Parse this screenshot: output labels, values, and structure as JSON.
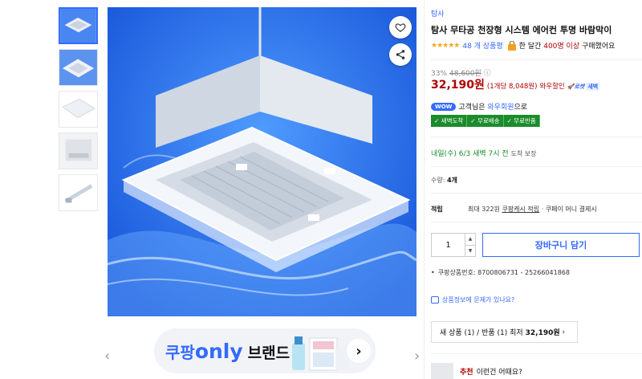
{
  "thumbnails": [
    {
      "name": "thumb-1",
      "active": true
    },
    {
      "name": "thumb-2",
      "active": false
    },
    {
      "name": "thumb-3",
      "active": false
    },
    {
      "name": "thumb-4",
      "active": false
    },
    {
      "name": "thumb-5",
      "active": false
    }
  ],
  "banner": {
    "text_brand": "쿠팡",
    "text_only": "only",
    "text_label": "브랜드",
    "arrow": "›"
  },
  "carousel": {
    "prev": "‹",
    "next": "›"
  },
  "product": {
    "brand": "탐사",
    "title": "탐사 무타공 천장형 시스템 에어컨 투명 바람막이",
    "stars": "★★★★★",
    "review_count": "48 개 상품평",
    "buy_prefix": "한 달간",
    "buy_count": "400명 이상",
    "buy_suffix": "구매했어요",
    "discount_rate": "33%",
    "original_price": "48,600원",
    "price": "32,190원",
    "unit_price": "(1개당 8,048원)",
    "wow_sale": "와우할인",
    "rocket_label": "로켓",
    "rocket_tag": "새벽",
    "wow_pill": "WOW",
    "wow_text": "고객님은",
    "wow_link": "와우회원",
    "wow_suffix": "으로",
    "benefit_tags": [
      "✓ 새벽도착",
      "✓ 무료배송",
      "✓ 무료반품"
    ],
    "delivery": "내일(수) 6/3 새벽 7시 전",
    "delivery_suffix": "도착 보장",
    "qty_label": "수량:",
    "qty_count": "4개",
    "point_label": "적립",
    "point_max": "최대 322원",
    "point_link": "쿠팡캐시 적립",
    "point_suffix": "· 쿠페이 머니 결제시",
    "quantity": "1",
    "cart_button": "장바구니 담기",
    "product_number": "쿠팡상품번호: 8700806731 - 25266041868",
    "report_link": "상품정보에 문제가 있나요?",
    "seller_info_prefix": "새 상품 (1) / 반품 (1) 최저",
    "seller_info_price": "32,190원",
    "seller_info_arrow": "›",
    "recommend_hot": "추천",
    "recommend_text": "이런건 어때요?"
  },
  "colors": {
    "accent": "#346aff",
    "price_red": "#ae0000",
    "green": "#1b8c2c",
    "star": "#f5a623"
  }
}
